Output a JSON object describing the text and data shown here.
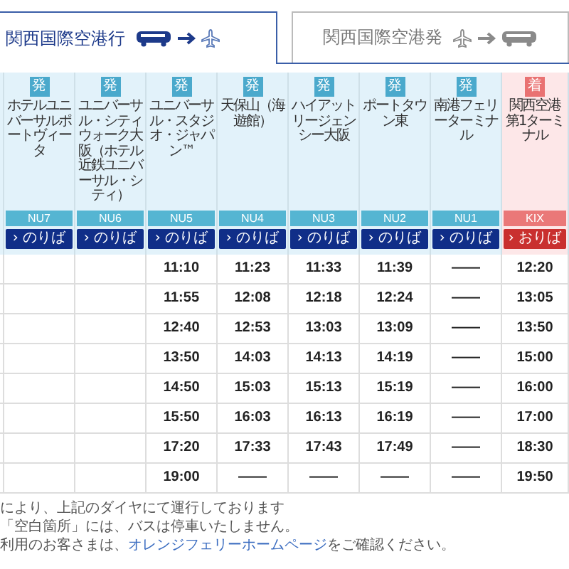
{
  "tabs": [
    {
      "label": "関西国際空港行",
      "selected": true,
      "kind": "to_airport"
    },
    {
      "label": "関西国際空港発",
      "selected": false,
      "kind": "from_airport"
    }
  ],
  "stops": [
    {
      "kind": "cut"
    },
    {
      "kind": "depart",
      "mark": "発",
      "name": "ホテルユニバーサルポートヴィータ",
      "code": "NU7",
      "button": "› のりば"
    },
    {
      "kind": "depart",
      "mark": "発",
      "name": "ユニバーサル・シティウォーク大阪（ホテル近鉄ユニバーサル・シティ）",
      "code": "NU6",
      "button": "› のりば"
    },
    {
      "kind": "depart",
      "mark": "発",
      "name": "ユニバーサル・スタジオ・ジャパン™",
      "code": "NU5",
      "button": "› のりば"
    },
    {
      "kind": "depart",
      "mark": "発",
      "name": "天保山（海遊館）",
      "code": "NU4",
      "button": "› のりば"
    },
    {
      "kind": "depart",
      "mark": "発",
      "name": "ハイアットリージェンシー大阪",
      "code": "NU3",
      "button": "› のりば"
    },
    {
      "kind": "depart",
      "mark": "発",
      "name": "ポートタウン東",
      "code": "NU2",
      "button": "› のりば"
    },
    {
      "kind": "depart",
      "mark": "発",
      "name": "南港フェリーターミナル",
      "code": "NU1",
      "button": "› のりば"
    },
    {
      "kind": "arrive",
      "mark": "着",
      "name": "関西空港第1ターミナル",
      "code": "KIX",
      "button": "› おりば"
    }
  ],
  "rows": [
    [
      null,
      null,
      null,
      "11:10",
      "11:23",
      "11:33",
      "11:39",
      "――",
      "12:20"
    ],
    [
      null,
      null,
      null,
      "11:55",
      "12:08",
      "12:18",
      "12:24",
      "――",
      "13:05"
    ],
    [
      null,
      null,
      null,
      "12:40",
      "12:53",
      "13:03",
      "13:09",
      "――",
      "13:50"
    ],
    [
      null,
      null,
      null,
      "13:50",
      "14:03",
      "14:13",
      "14:19",
      "――",
      "15:00"
    ],
    [
      null,
      null,
      null,
      "14:50",
      "15:03",
      "15:13",
      "15:19",
      "――",
      "16:00"
    ],
    [
      null,
      null,
      null,
      "15:50",
      "16:03",
      "16:13",
      "16:19",
      "――",
      "17:00"
    ],
    [
      null,
      null,
      null,
      "17:20",
      "17:33",
      "17:43",
      "17:49",
      "――",
      "18:30"
    ],
    [
      null,
      null,
      null,
      "19:00",
      "――",
      "――",
      "――",
      "――",
      "19:50"
    ]
  ],
  "notes": [
    {
      "text": "により、上記のダイヤにて運行しております"
    },
    {
      "text": "「空白箇所」には、バスは停車いたしません。"
    },
    {
      "text": "利用のお客さまは、",
      "link": "オレンジフェリーホームページ",
      "after": "をご確認ください。"
    }
  ]
}
